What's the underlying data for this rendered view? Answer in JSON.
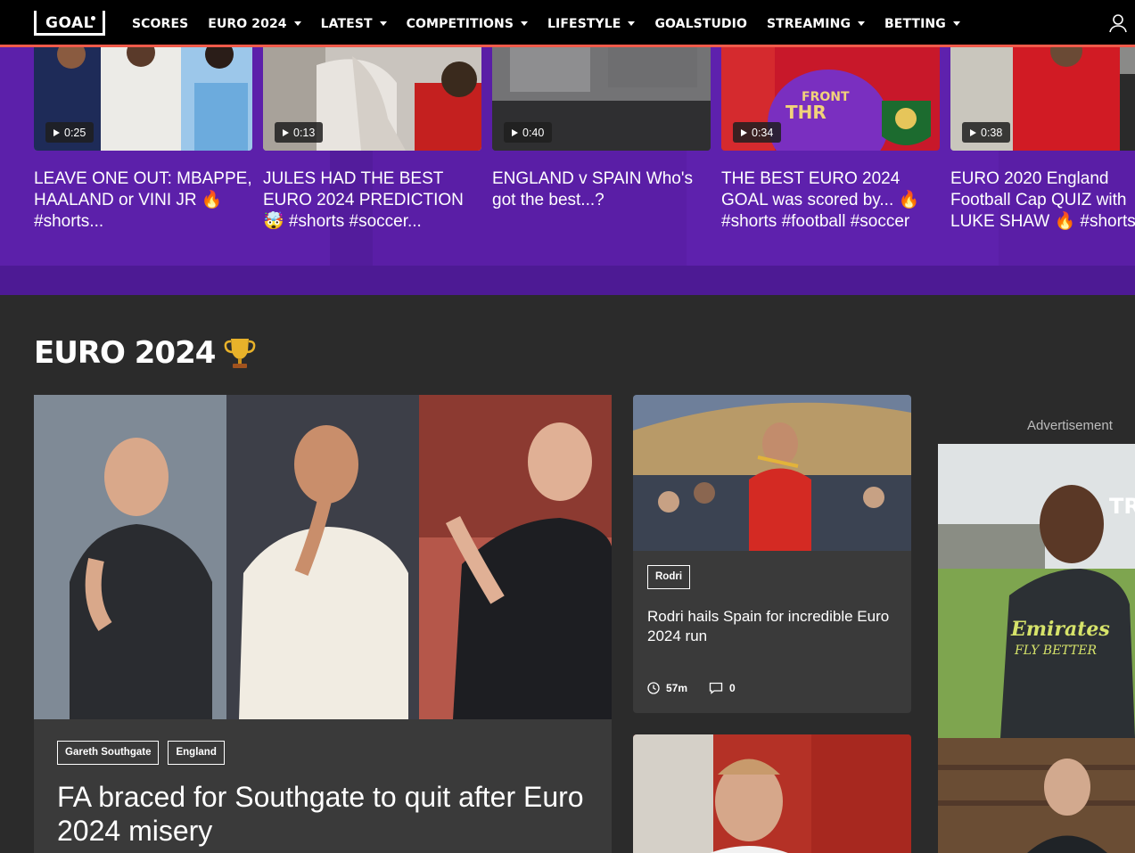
{
  "nav": {
    "logo": "GOAL",
    "items": [
      {
        "label": "SCORES",
        "dropdown": false
      },
      {
        "label": "EURO 2024",
        "dropdown": true
      },
      {
        "label": "LATEST",
        "dropdown": true
      },
      {
        "label": "COMPETITIONS",
        "dropdown": true
      },
      {
        "label": "LIFESTYLE",
        "dropdown": true
      },
      {
        "label": "GOALSTUDIO",
        "dropdown": false
      },
      {
        "label": "STREAMING",
        "dropdown": true
      },
      {
        "label": "BETTING",
        "dropdown": true
      }
    ],
    "accent": "#f05a4a"
  },
  "videos": [
    {
      "duration": "0:25",
      "title": "LEAVE ONE OUT: MBAPPE, HAALAND or VINI JR 🔥 #shorts..."
    },
    {
      "duration": "0:13",
      "title": "JULES HAD THE BEST EURO 2024 PREDICTION 🤯 #shorts #soccer..."
    },
    {
      "duration": "0:40",
      "title": "ENGLAND v SPAIN Who's got the best...?"
    },
    {
      "duration": "0:34",
      "title": "THE BEST EURO 2024 GOAL was scored by... 🔥 #shorts #football #soccer"
    },
    {
      "duration": "0:38",
      "title": "EURO 2020 England Football Cap QUIZ with LUKE SHAW 🔥 #shorts"
    }
  ],
  "section": {
    "title": "EURO 2024",
    "icon": "trophy-icon"
  },
  "hero": {
    "tags": [
      "Gareth Southgate",
      "England"
    ],
    "title": "FA braced for Southgate to quit after Euro 2024 misery"
  },
  "side_article": {
    "tag": "Rodri",
    "title": "Rodri hails Spain for incredible Euro 2024 run",
    "time": "57m",
    "comments": "0"
  },
  "ad": {
    "label": "Advertisement"
  },
  "colors": {
    "strip": "#5a1ea6",
    "page_bg": "#2b2b2b",
    "card_bg": "#3a3a3a"
  }
}
